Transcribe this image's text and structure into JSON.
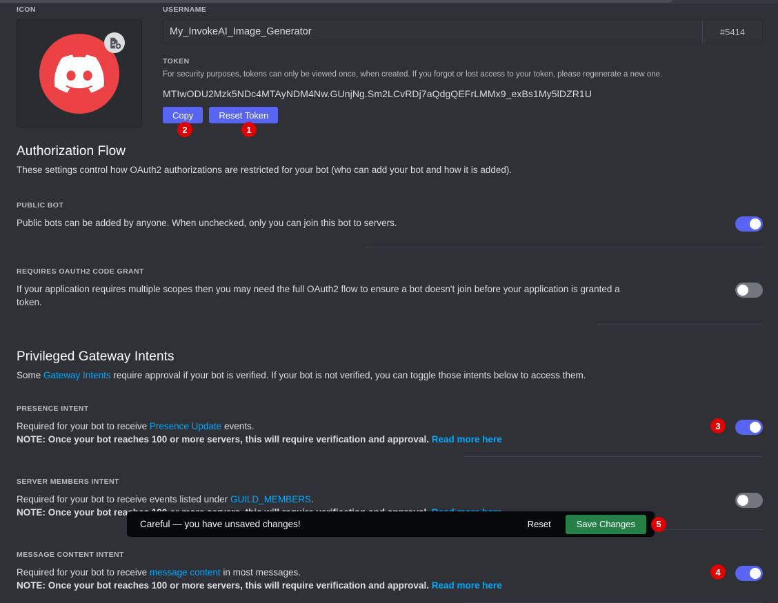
{
  "icon": {
    "label": "ICON",
    "avatar_icon": "discord-logo-icon",
    "upload_badge_icon": "add-image-icon",
    "avatar_color": "#ed4245"
  },
  "username": {
    "label": "USERNAME",
    "value": "My_InvokeAI_Image_Generator",
    "discriminator": "#5414"
  },
  "token": {
    "label": "TOKEN",
    "description": "For security purposes, tokens can only be viewed once, when created. If you forgot or lost access to your token, please regenerate a new one.",
    "value": "MTIwODU2Mzk5NDc4MTAyNDM4Nw.GUnjNg.Sm2LCvRDj7aQdgQEFrLMMx9_exBs1My5lDZR1U",
    "copy_label": "Copy",
    "reset_label": "Reset Token",
    "copy_badge": "2",
    "reset_badge": "1"
  },
  "authorization_flow": {
    "title": "Authorization Flow",
    "description": "These settings control how OAuth2 authorizations are restricted for your bot (who can add your bot and how it is added).",
    "public_bot": {
      "label": "PUBLIC BOT",
      "description": "Public bots can be added by anyone. When unchecked, only you can join this bot to servers.",
      "state": "on"
    },
    "oauth2_code_grant": {
      "label": "REQUIRES OAUTH2 CODE GRANT",
      "description": "If your application requires multiple scopes then you may need the full OAuth2 flow to ensure a bot doesn't join before your application is granted a token.",
      "state": "off"
    }
  },
  "gateway_intents": {
    "title": "Privileged Gateway Intents",
    "desc_prefix": "Some ",
    "desc_link": "Gateway Intents",
    "desc_suffix": " require approval if your bot is verified. If your bot is not verified, you can toggle those intents below to access them.",
    "presence": {
      "label": "PRESENCE INTENT",
      "desc_prefix": "Required for your bot to receive ",
      "desc_link": "Presence Update",
      "desc_suffix": " events.",
      "note": "NOTE: Once your bot reaches 100 or more servers, this will require verification and approval.",
      "note_link": "Read more here",
      "state": "on",
      "badge": "3"
    },
    "server_members": {
      "label": "SERVER MEMBERS INTENT",
      "desc_prefix": "Required for your bot to receive events listed under ",
      "desc_link": "GUILD_MEMBERS",
      "desc_suffix": ".",
      "note": "NOTE: Once your bot reaches 100 or more servers, this will require verification and approval.",
      "note_link": "Read more here",
      "state": "off"
    },
    "message_content": {
      "label": "MESSAGE CONTENT INTENT",
      "desc_prefix": "Required for your bot to receive ",
      "desc_link": "message content",
      "desc_suffix": " in most messages.",
      "note": "NOTE: Once your bot reaches 100 or more servers, this will require verification and approval.",
      "note_link": "Read more here",
      "state": "on",
      "badge": "4"
    }
  },
  "unsaved_bar": {
    "message": "Careful — you have unsaved changes!",
    "reset_label": "Reset",
    "save_label": "Save Changes",
    "save_badge": "5",
    "save_color": "#248046"
  }
}
